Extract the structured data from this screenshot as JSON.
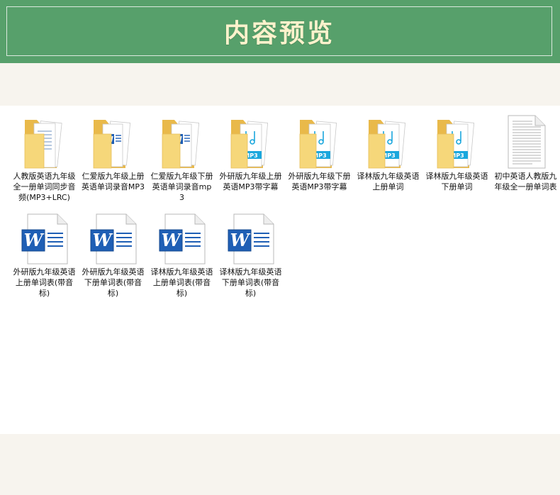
{
  "banner": {
    "title": "内容预览"
  },
  "colors": {
    "banner_bg": "#57a06b",
    "banner_text": "#fdf2cc",
    "page_bg": "#f7f4ee",
    "panel_bg": "#ffffff",
    "folder_yellow": "#f6d77a",
    "mp3_blue": "#1aa7dd",
    "word_blue": "#1f5fb5"
  },
  "files": [
    {
      "name": "人教版英语九年级全一册单词同步音频(MP3+LRC)",
      "icon": "folder-doc-icon"
    },
    {
      "name": "仁爱版九年级上册英语单词录音MP3",
      "icon": "folder-word-icon"
    },
    {
      "name": "仁爱版九年级下册英语单词录音mp3",
      "icon": "folder-word-icon"
    },
    {
      "name": "外研版九年级上册英语MP3带字幕",
      "icon": "folder-mp3-icon"
    },
    {
      "name": "外研版九年级下册英语MP3带字幕",
      "icon": "folder-mp3-icon"
    },
    {
      "name": "译林版九年级英语上册单词",
      "icon": "folder-mp3-icon"
    },
    {
      "name": "译林版九年级英语下册单词",
      "icon": "folder-mp3-icon"
    },
    {
      "name": "初中英语人教版九年级全一册单词表",
      "icon": "text-document-icon"
    },
    {
      "name": "外研版九年级英语上册单词表(带音标)",
      "icon": "word-document-icon"
    },
    {
      "name": "外研版九年级英语下册单词表(带音标)",
      "icon": "word-document-icon"
    },
    {
      "name": "译林版九年级英语上册单词表(带音标)",
      "icon": "word-document-icon"
    },
    {
      "name": "译林版九年级英语下册单词表(带音标)",
      "icon": "word-document-icon"
    }
  ]
}
